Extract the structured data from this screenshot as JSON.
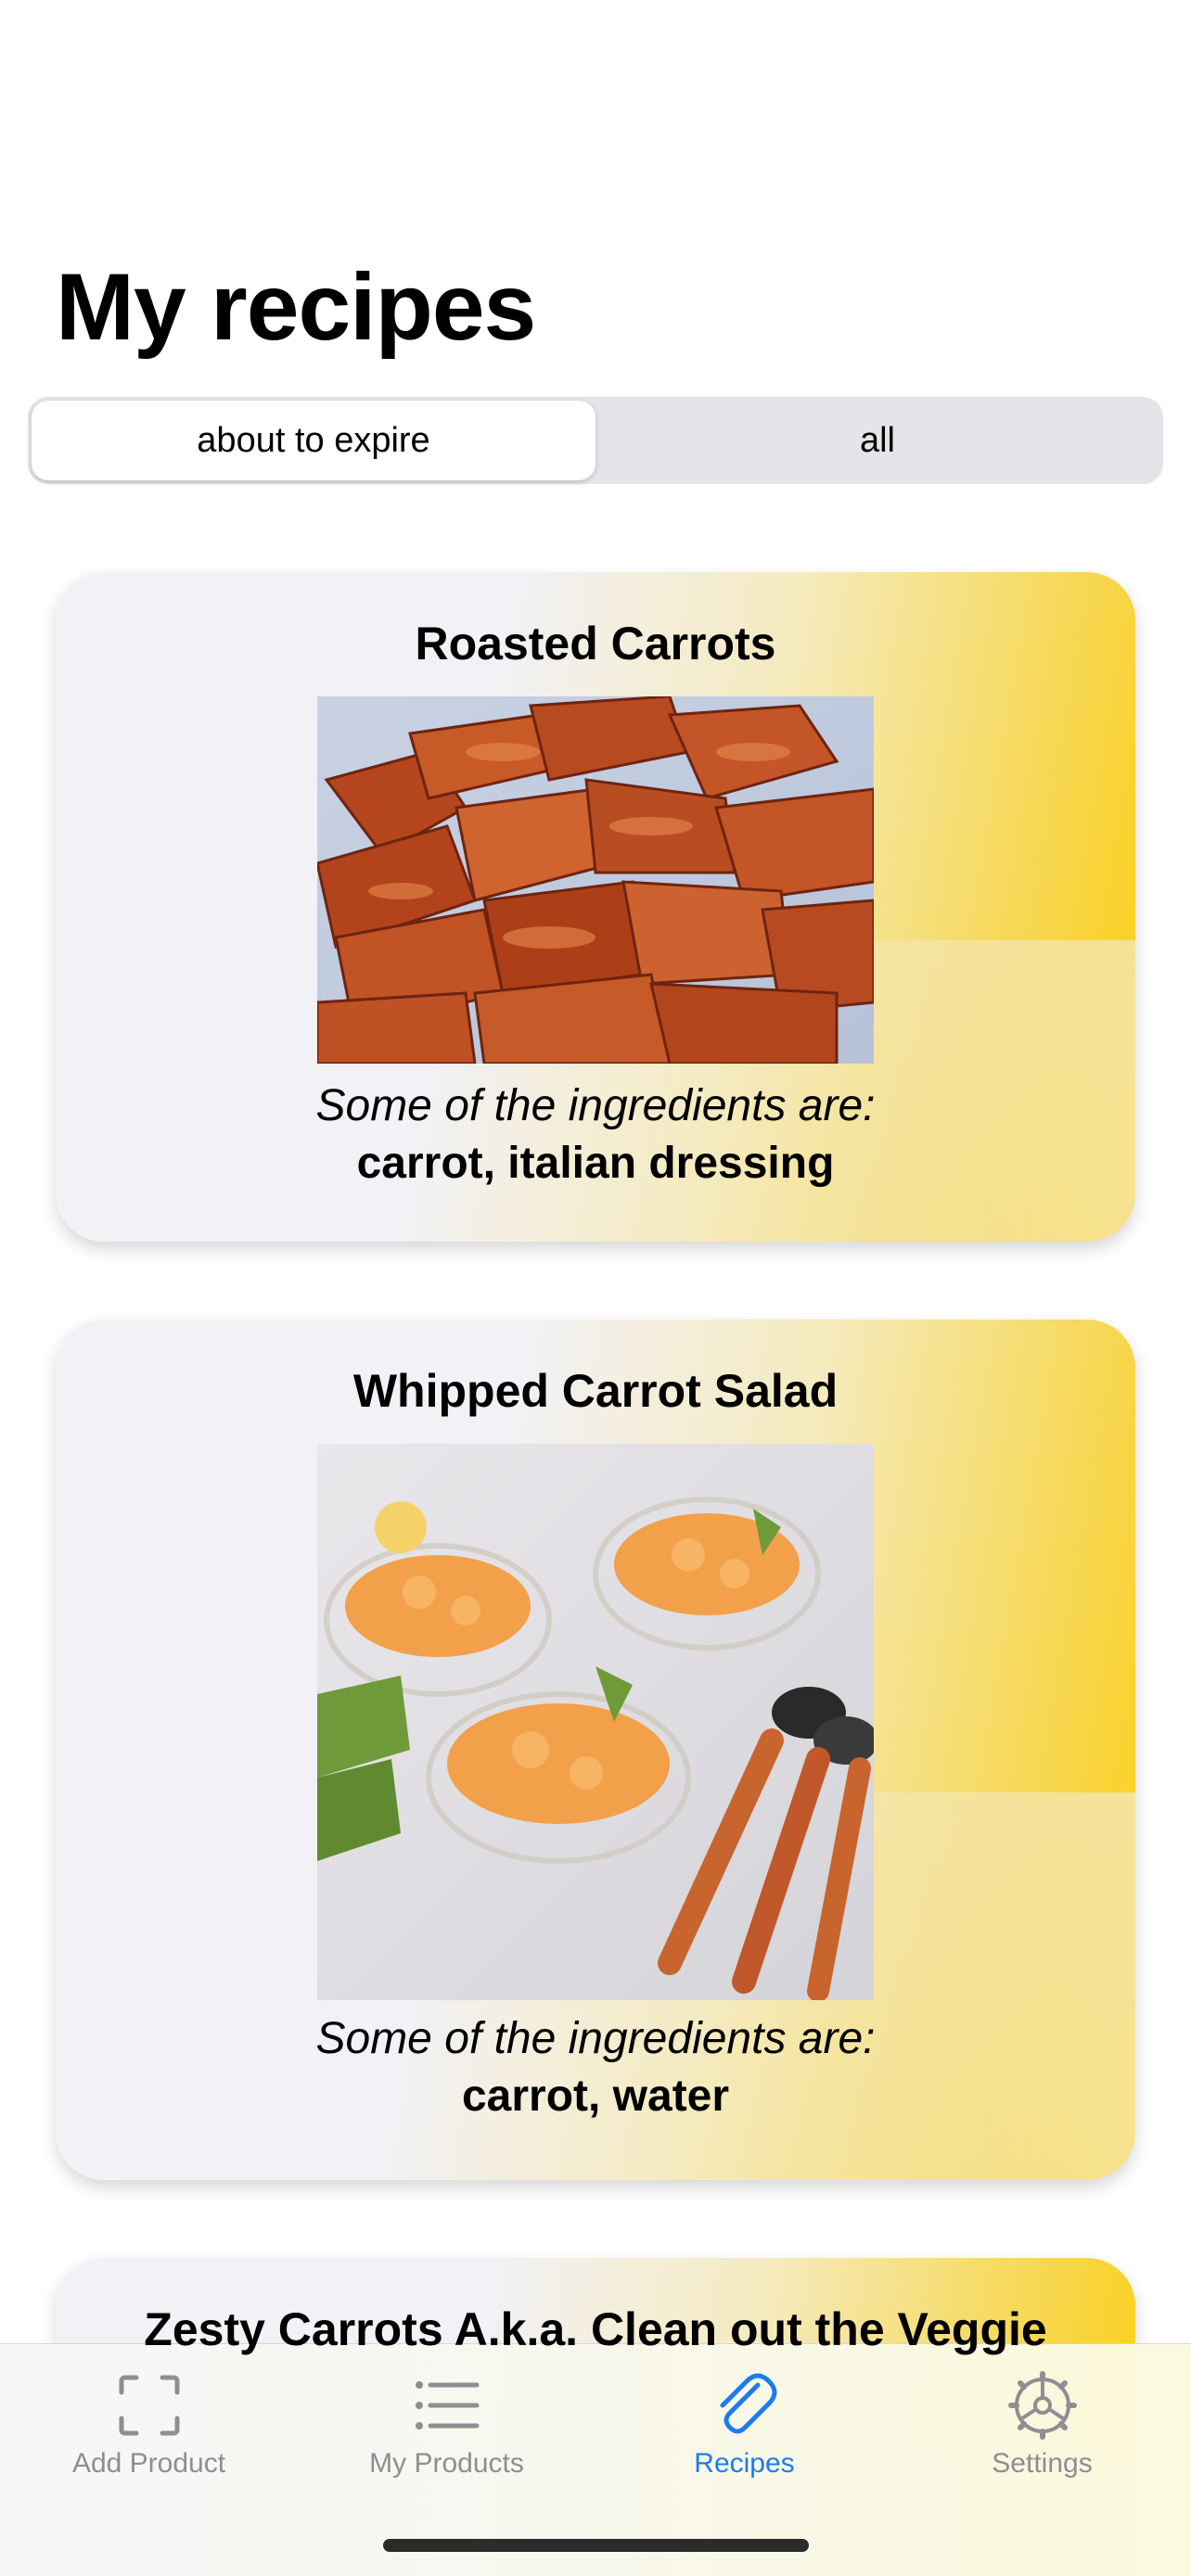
{
  "page": {
    "title": "My recipes"
  },
  "filter": {
    "segments": [
      {
        "label": "about to expire",
        "selected": true
      },
      {
        "label": "all",
        "selected": false
      }
    ]
  },
  "recipes": [
    {
      "title": "Roasted Carrots",
      "image": "roasted-carrots-photo",
      "ingredients_caption": "Some of the ingredients are:",
      "ingredients": "carrot, italian dressing"
    },
    {
      "title": "Whipped Carrot Salad",
      "image": "whipped-carrot-salad-photo",
      "ingredients_caption": "Some of the ingredients are:",
      "ingredients": "carrot, water"
    },
    {
      "title": "Zesty Carrots A.k.a. Clean out the Veggie"
    }
  ],
  "tab_bar": {
    "items": [
      {
        "label": "Add Product",
        "icon": "scan-frame-icon",
        "active": false
      },
      {
        "label": "My Products",
        "icon": "list-icon",
        "active": false
      },
      {
        "label": "Recipes",
        "icon": "paperclip-icon",
        "active": true
      },
      {
        "label": "Settings",
        "icon": "gear-icon",
        "active": false
      }
    ]
  },
  "colors": {
    "accent": "#1a7cf5",
    "card_gradient_end": "#fbcf10",
    "card_base": "#f2f1f6",
    "inactive_tab": "#8e8e93"
  }
}
